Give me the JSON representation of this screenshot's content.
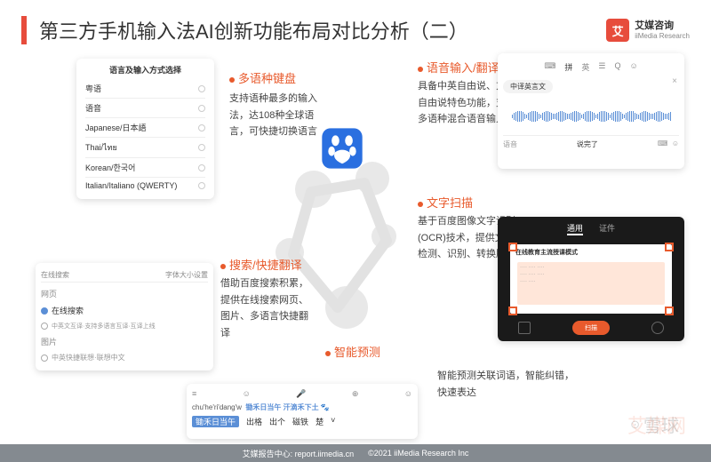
{
  "header": {
    "title": "第三方手机输入法AI创新功能布局对比分析（二）",
    "brand_logo": "艾",
    "brand_cn": "艾媒咨询",
    "brand_en": "iiMedia Research"
  },
  "features": {
    "multilang": {
      "label": "多语种键盘",
      "desc": "支持语种最多的输入法，达108种全球语言，可快捷切换语言"
    },
    "search": {
      "label": "搜索/快捷翻译",
      "desc": "借助百度搜索积累，提供在线搜索网页、图片、多语言快捷翻译"
    },
    "voice": {
      "label": "语音输入/翻译",
      "desc": "具备中英自由说、方言自由说特色功能，支持多语种混合语音输入"
    },
    "ocr": {
      "label": "文字扫描",
      "desc": "基于百度图像文字识别(OCR)技术，提供文字检测、识别、转换服务"
    },
    "predict": {
      "label": "智能预测",
      "desc": "智能预测关联词语，智能纠错，快速表达"
    }
  },
  "panels": {
    "lang": {
      "title": "语言及输入方式选择",
      "items": [
        "粤语",
        "语音",
        "Japanese/日本語",
        "Thai/ไทย",
        "Korean/한국어",
        "Italian/Italiano (QWERTY)"
      ]
    },
    "search": {
      "tab_left": "在线搜索",
      "tab_right": "字体大小设置",
      "col1": "网页",
      "col2": "图片",
      "opt1": "在线搜索",
      "opt2": "中英文互译·支持多语言互译·互译上线",
      "opt3": "中英快捷联想·联想中文"
    },
    "voice": {
      "tabs": [
        "⌨",
        "拼",
        "英",
        "☰",
        "Q",
        "☺"
      ],
      "chip": "中译英言文",
      "bot_left": "语音",
      "bot_mid": "说完了",
      "bot_r1": "⌨",
      "bot_r2": "☺"
    },
    "ocr": {
      "tab1": "通用",
      "tab2": "证件",
      "frame_title": "在线教育主流授课模式",
      "btn": "扫描",
      "ico_l": "图",
      "ico_r": "⊞"
    },
    "input": {
      "pinyin": "chu'he'ri'dang'w",
      "hint": "锄禾日当午 汗滴禾下土",
      "cands": [
        "锄禾日当午",
        "出格",
        "出个",
        "磁铁",
        "楚"
      ]
    }
  },
  "footer": {
    "left": "艾媒报告中心: report.iimedia.cn",
    "right": "©2021 iiMedia Research Inc"
  },
  "watermark": {
    "a": "雪球",
    "b": "艾媒网"
  }
}
